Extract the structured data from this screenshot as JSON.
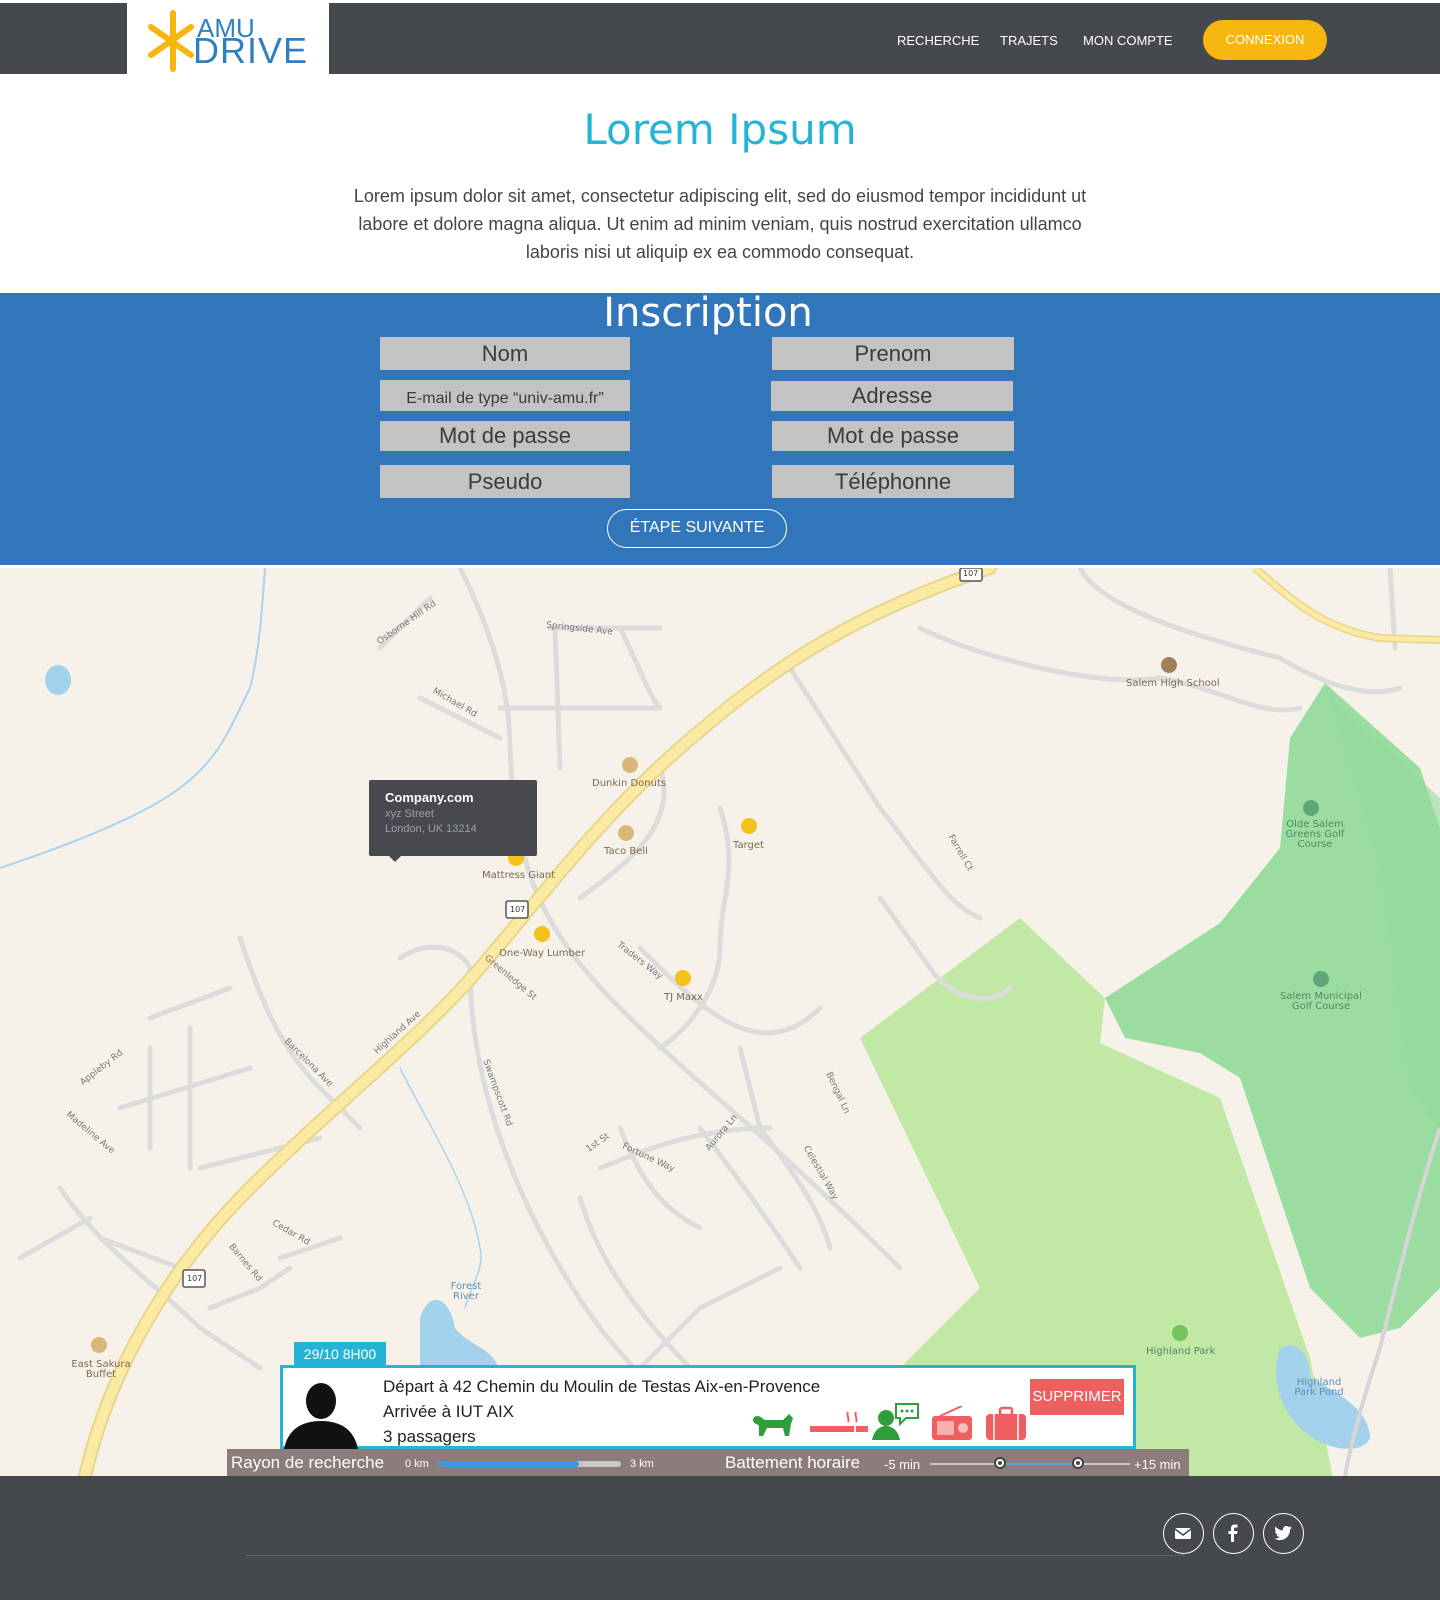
{
  "brand": {
    "logo_top": "AMU",
    "logo_bottom": "DRIVE",
    "accent": "#f7b60e",
    "primary": "#2f7fc3"
  },
  "nav": {
    "search": "RECHERCHE",
    "trips": "TRAJETS",
    "account": "MON COMPTE",
    "login": "CONNEXION"
  },
  "hero": {
    "title": "Lorem Ipsum",
    "text": "Lorem ipsum dolor sit amet, consectetur adipiscing elit, sed do eiusmod tempor incididunt ut labore et dolore magna aliqua. Ut enim ad minim veniam, quis nostrud exercitation ullamco laboris nisi ut aliquip ex ea commodo consequat."
  },
  "signup": {
    "title": "Inscription",
    "last_name": "Nom",
    "first_name": "Prenom",
    "email": "E-mail de type “univ-amu.fr”",
    "address": "Adresse",
    "password": "Mot de passe",
    "password_confirm": "Mot de passe",
    "username": "Pseudo",
    "phone": "Téléphonne",
    "next": "ÉTAPE SUIVANTE"
  },
  "map": {
    "popup": {
      "title": "Company.com",
      "street": "xyz Street",
      "city": "London, UK 13214"
    },
    "pois": {
      "dunkin": "Dunkin Donuts",
      "taco": "Taco Bell",
      "target": "Target",
      "mattress": "Mattress Giant",
      "lumber": "One-Way Lumber",
      "tjmaxx": "TJ Maxx",
      "school": "Salem High School",
      "golf1": "Olde Salem Greens Golf Course",
      "golf2": "Salem Municipal Golf Course",
      "park": "Highland Park",
      "pond": "Highland Park Pond",
      "river": "Forest River",
      "buffet": "East Sakura Buffet"
    },
    "roads": {
      "highland": "Highland Ave",
      "swampscott": "Swampscott Rd",
      "traders": "Traders Way",
      "greenledge": "Greenledge St",
      "barcelona": "Barcelona Ave",
      "springside": "Springside Ave",
      "michael": "Michael Rd",
      "osborne": "Osborne Hill Rd",
      "appleby": "Appleby Rd",
      "madeline": "Madeline Ave",
      "cedar": "Cedar Rd",
      "barnes": "Barnes Rd",
      "fortune": "Fortune Way",
      "celestial": "Celestial Way",
      "aurora": "Aurora Ln",
      "first": "1st St",
      "farrell": "Farrell Ct",
      "bengal": "Bengal Ln",
      "route": "107"
    }
  },
  "trip": {
    "date": "29/10  8H00",
    "departure": "Départ à 42 Chemin du Moulin de Testas Aix-en-Provence",
    "arrival": "Arrivée à IUT AIX",
    "passengers": "3 passagers",
    "delete": "SUPPRIMER",
    "options": [
      "pets-icon",
      "smoking-icon",
      "chat-icon",
      "radio-icon",
      "luggage-icon"
    ]
  },
  "filter": {
    "radius_label": "Rayon de recherche",
    "radius_min": "0 km",
    "radius_max": "3 km",
    "radius_value": 0.77,
    "time_label": "Battement horaire",
    "time_min": "-5 min",
    "time_max": "+15 min",
    "time_low": 0.35,
    "time_high": 0.74
  },
  "footer": {
    "social": [
      "mail-icon",
      "facebook-icon",
      "twitter-icon"
    ]
  }
}
